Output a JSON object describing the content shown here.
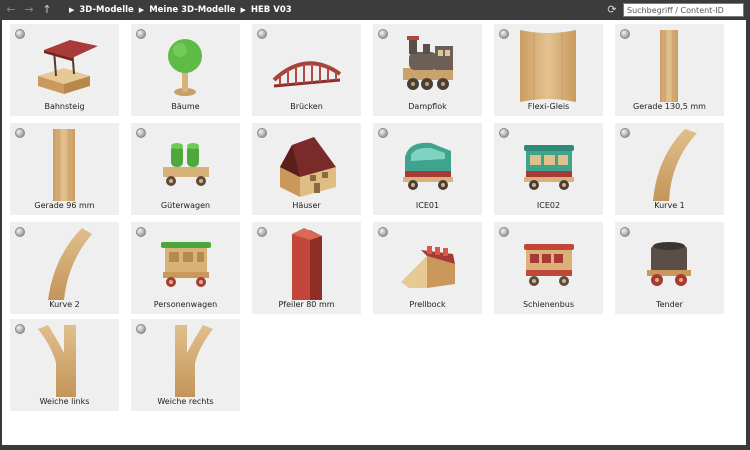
{
  "toolbar": {
    "breadcrumbs": [
      "3D-Modelle",
      "Meine 3D-Modelle",
      "HEB V03"
    ],
    "search_placeholder": "Suchbegriff / Content-ID"
  },
  "items": [
    {
      "label": "Bahnsteig",
      "icon": "platform-model-icon"
    },
    {
      "label": "Bäume",
      "icon": "tree-model-icon"
    },
    {
      "label": "Brücken",
      "icon": "bridge-model-icon"
    },
    {
      "label": "Dampflok",
      "icon": "steam-locomotive-model-icon"
    },
    {
      "label": "Flexi-Gleis",
      "icon": "flex-track-model-icon"
    },
    {
      "label": "Gerade 130,5 mm",
      "icon": "straight-track-long-model-icon"
    },
    {
      "label": "Gerade 96 mm",
      "icon": "straight-track-short-model-icon"
    },
    {
      "label": "Güterwagen",
      "icon": "freight-wagon-model-icon"
    },
    {
      "label": "Häuser",
      "icon": "house-model-icon"
    },
    {
      "label": "ICE01",
      "icon": "ice01-train-model-icon"
    },
    {
      "label": "ICE02",
      "icon": "ice02-train-model-icon"
    },
    {
      "label": "Kurve 1",
      "icon": "curve-track-1-model-icon"
    },
    {
      "label": "Kurve 2",
      "icon": "curve-track-2-model-icon"
    },
    {
      "label": "Personenwagen",
      "icon": "passenger-car-model-icon"
    },
    {
      "label": "Pfeiler 80 mm",
      "icon": "pillar-model-icon"
    },
    {
      "label": "Prellbock",
      "icon": "buffer-stop-model-icon"
    },
    {
      "label": "Schienenbus",
      "icon": "railbus-model-icon"
    },
    {
      "label": "Tender",
      "icon": "tender-model-icon"
    },
    {
      "label": "Weiche links",
      "icon": "switch-left-model-icon"
    },
    {
      "label": "Weiche rechts",
      "icon": "switch-right-model-icon"
    }
  ]
}
